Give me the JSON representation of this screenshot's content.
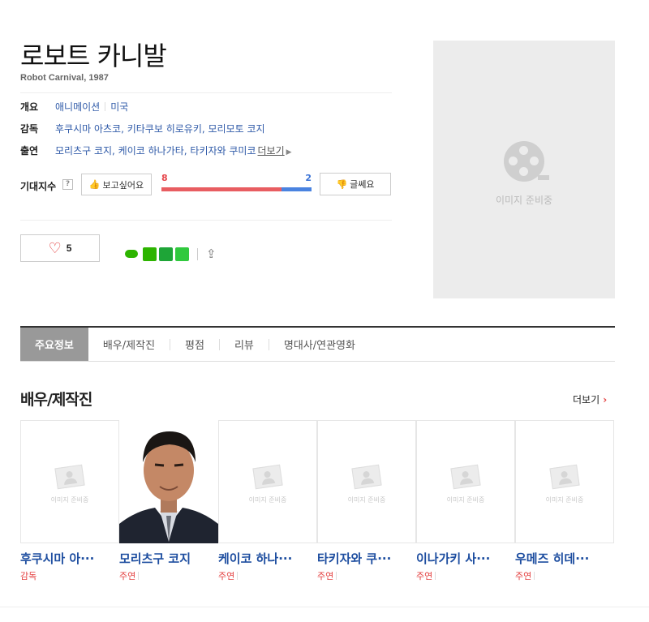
{
  "movie": {
    "title": "로보트 카니발",
    "subtitle": "Robot Carnival, 1987"
  },
  "info": {
    "overview_label": "개요",
    "genre": "애니메이션",
    "country": "미국",
    "director_label": "감독",
    "directors": "후쿠시마 아츠코, 키타쿠보 히로유키, 모리모토 코지",
    "cast_label": "출연",
    "cast": "모리츠구 코지, 케이코 하나가타, 타키자와 쿠미코",
    "cast_more": "더보기"
  },
  "expectation": {
    "label": "기대지수",
    "help": "?",
    "want_label": "보고싶어요",
    "want_count": "8",
    "boring_count": "2",
    "boring_label": "글쎄요",
    "want_ratio": 0.8
  },
  "social": {
    "like_count": "5",
    "icons": [
      "line-share-icon",
      "band-share-icon",
      "bookmark-share-icon",
      "naver-share-icon",
      "share-out-icon"
    ]
  },
  "poster": {
    "placeholder_text": "이미지 준비중"
  },
  "tabs": [
    {
      "label": "주요정보"
    },
    {
      "label": "배우/제작진"
    },
    {
      "label": "평점"
    },
    {
      "label": "리뷰"
    },
    {
      "label": "명대사/연관영화"
    }
  ],
  "cast_section": {
    "heading": "배우/제작진",
    "more": "더보기",
    "photo_placeholder": "이미지 준비중",
    "people": [
      {
        "name": "후쿠시마 아···",
        "role": "감독"
      },
      {
        "name": "모리츠구 코지",
        "role": "주연"
      },
      {
        "name": "케이코 하나···",
        "role": "주연"
      },
      {
        "name": "타키자와 쿠···",
        "role": "주연"
      },
      {
        "name": "이나가키 사···",
        "role": "주연"
      },
      {
        "name": "우메즈 히데···",
        "role": "주연"
      }
    ]
  },
  "colors": {
    "link_blue": "#2f5aa8",
    "accent_red": "#e33e3e",
    "bar_red": "#e85d61",
    "bar_blue": "#4a83e0"
  }
}
